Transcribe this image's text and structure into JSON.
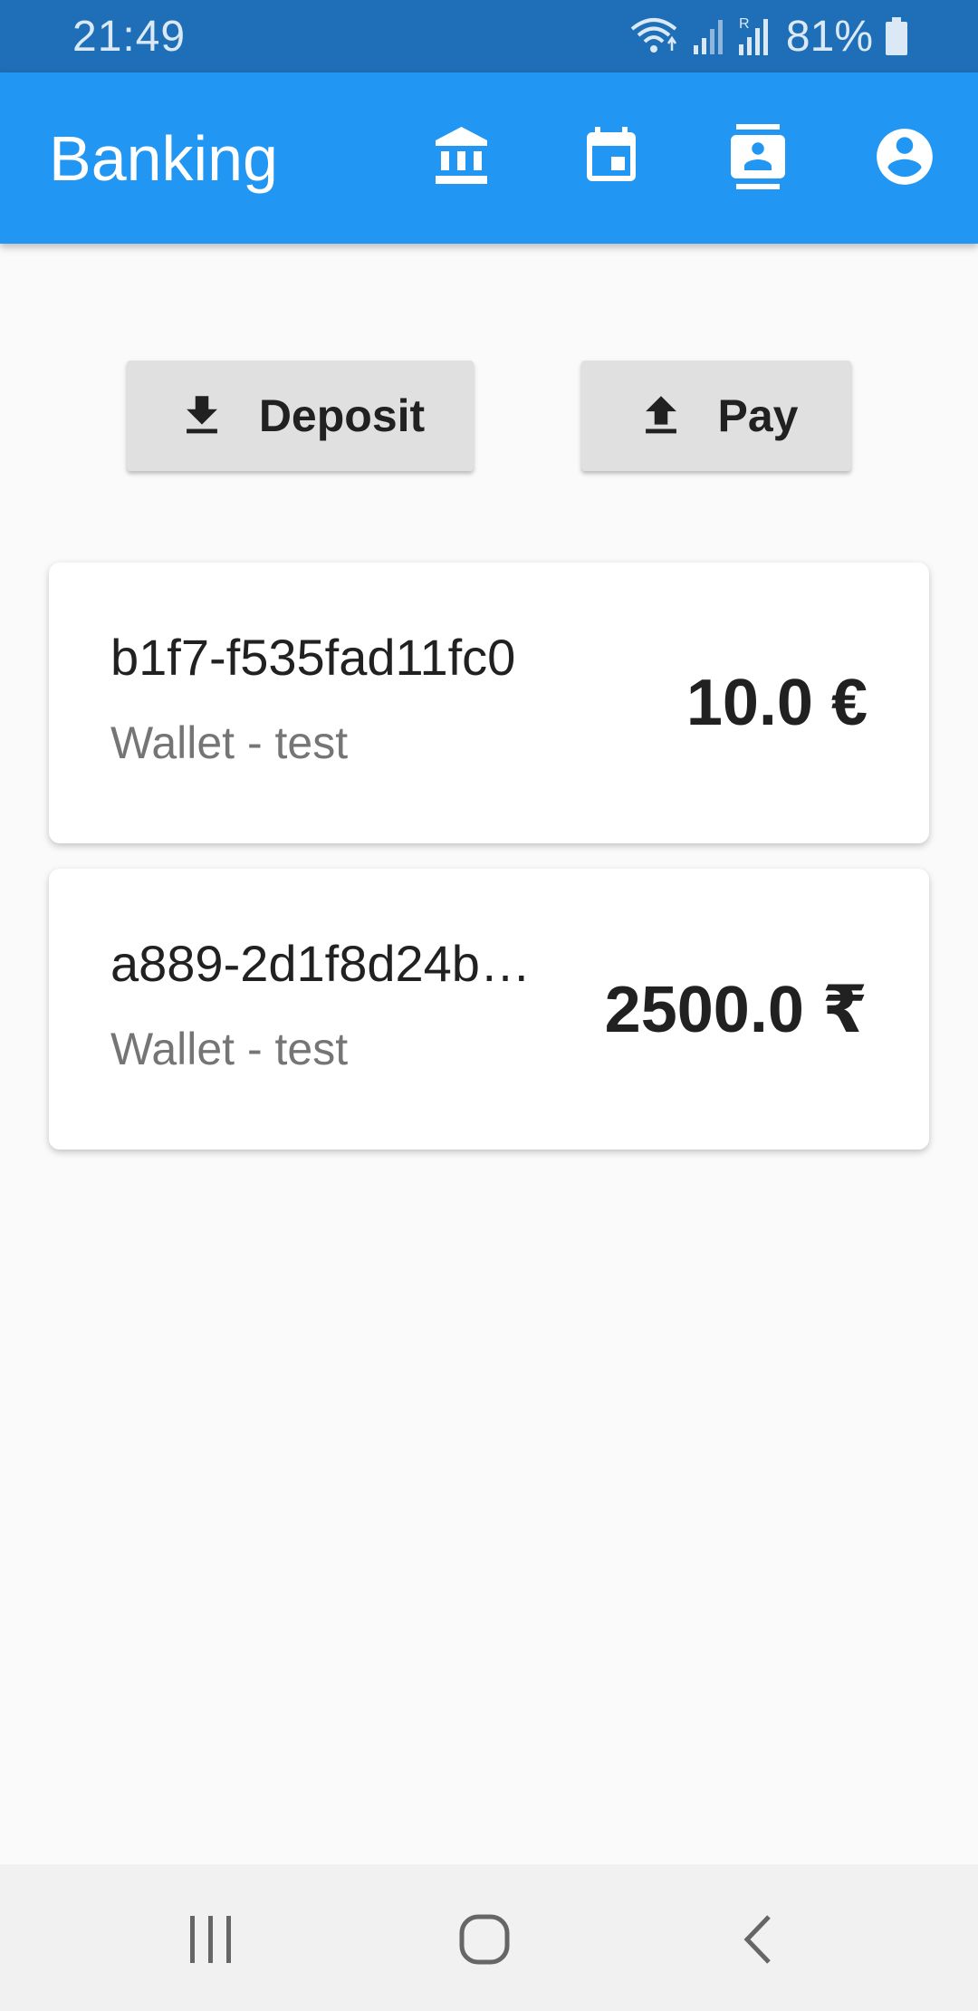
{
  "status_bar": {
    "time": "21:49",
    "battery": "81%",
    "icons": [
      "wifi-icon",
      "signal-icon",
      "signal-roaming-icon",
      "battery-icon"
    ]
  },
  "app_bar": {
    "title": "Banking",
    "actions": [
      "bank-icon",
      "calendar-icon",
      "contacts-icon",
      "account-circle-icon"
    ],
    "background": "#2196f3"
  },
  "actions": {
    "deposit_label": "Deposit",
    "pay_label": "Pay",
    "deposit_icon": "download-icon",
    "pay_icon": "upload-icon"
  },
  "wallets": [
    {
      "id": "b1f7-f535fad11fc0",
      "subtitle": "Wallet - test",
      "amount": "10.0 €"
    },
    {
      "id": "a889-2d1f8d24b…",
      "subtitle": "Wallet - test",
      "amount": "2500.0 ₹"
    }
  ],
  "nav_bar": {
    "buttons": [
      "recent-apps-icon",
      "home-icon",
      "back-icon"
    ]
  }
}
